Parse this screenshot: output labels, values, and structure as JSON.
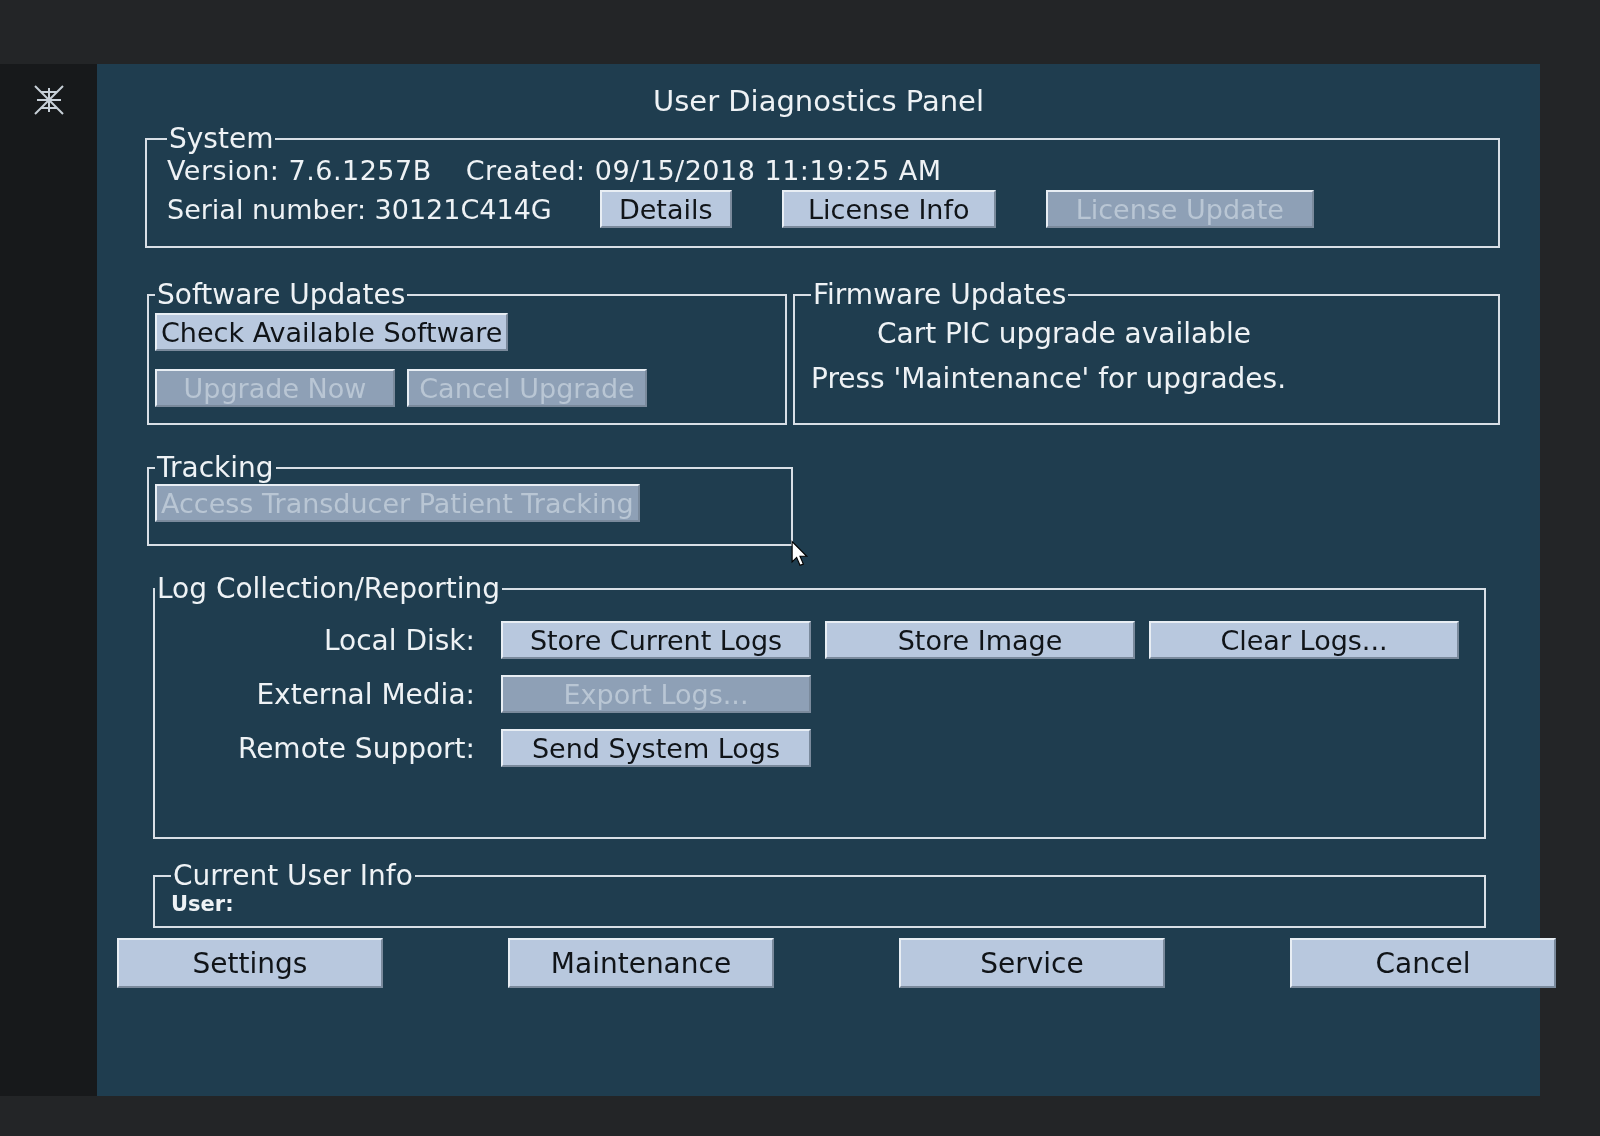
{
  "window": {
    "title": "User Diagnostics Panel"
  },
  "system": {
    "legend": "System",
    "version": "Version: 7.6.1257B",
    "created": "Created: 09/15/2018 11:19:25 AM",
    "serial": "Serial number: 30121C414G",
    "buttons": [
      {
        "label": "Details",
        "disabled": false
      },
      {
        "label": "License Info",
        "disabled": false
      },
      {
        "label": "License Update",
        "disabled": true
      }
    ]
  },
  "software_updates": {
    "legend": "Software Updates",
    "check_button": {
      "label": "Check Available Software",
      "disabled": false
    },
    "buttons": [
      {
        "label": "Upgrade Now",
        "disabled": true
      },
      {
        "label": "Cancel Upgrade",
        "disabled": true
      }
    ]
  },
  "firmware_updates": {
    "legend": "Firmware Updates",
    "lines": [
      "Cart PIC upgrade available",
      "Press 'Maintenance' for upgrades."
    ]
  },
  "tracking": {
    "legend": "Tracking",
    "button": {
      "label": "Access Transducer Patient Tracking",
      "disabled": true
    }
  },
  "log_collection": {
    "legend": "Log Collection/Reporting",
    "rows": [
      {
        "label": "Local Disk:",
        "buttons": [
          {
            "label": "Store Current Logs",
            "disabled": false
          },
          {
            "label": "Store Image",
            "disabled": false
          },
          {
            "label": "Clear Logs...",
            "disabled": false
          }
        ]
      },
      {
        "label": "External Media:",
        "buttons": [
          {
            "label": "Export Logs...",
            "disabled": true
          }
        ]
      },
      {
        "label": "Remote Support:",
        "buttons": [
          {
            "label": "Send System Logs",
            "disabled": false
          }
        ]
      }
    ]
  },
  "current_user_info": {
    "legend": "Current User Info",
    "user_label": "User:"
  },
  "footer_buttons": [
    {
      "label": "Settings",
      "disabled": false
    },
    {
      "label": "Maintenance",
      "disabled": false
    },
    {
      "label": "Service",
      "disabled": false
    },
    {
      "label": "Cancel",
      "disabled": false
    }
  ]
}
